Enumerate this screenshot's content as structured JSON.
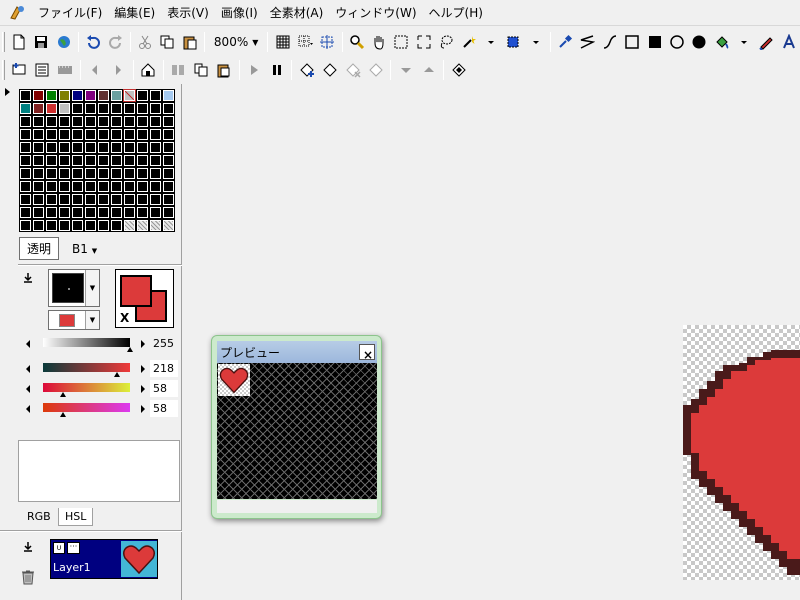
{
  "menu": {
    "items": [
      "ファイル(F)",
      "編集(E)",
      "表示(V)",
      "画像(I)",
      "全素材(A)",
      "ウィンドウ(W)",
      "ヘルプ(H)"
    ]
  },
  "toolbar": {
    "zoom_value": "800%"
  },
  "palette": {
    "top_row_colors": [
      "#000000",
      "#800000",
      "#008000",
      "#808000",
      "#000080",
      "#800080",
      "#603030",
      "#6aa0a0",
      "#c0c0c0",
      "#000000",
      "#000000",
      "#a6caf0"
    ],
    "second_row_colors": [
      "#008080",
      "#802020",
      "#d03030",
      "#c0c0c0"
    ]
  },
  "layer_controls": {
    "transparent_label": "透明",
    "layer_select_value": "B1"
  },
  "colors": {
    "main": "#000000",
    "sub": "#dc3a3a",
    "swap_label": "X",
    "accent_red": "#dc3a3a"
  },
  "sliders": {
    "gray": {
      "value": "255",
      "fraction": 1.0
    },
    "c1": {
      "value": "218",
      "fraction": 0.85
    },
    "c2": {
      "value": "58",
      "fraction": 0.23
    },
    "c3": {
      "value": "58",
      "fraction": 0.23
    }
  },
  "tabs": {
    "rgb": "RGB",
    "hsl": "HSL"
  },
  "layers": {
    "name": "Layer1"
  },
  "preview": {
    "title": "プレビュー",
    "close": "×"
  }
}
